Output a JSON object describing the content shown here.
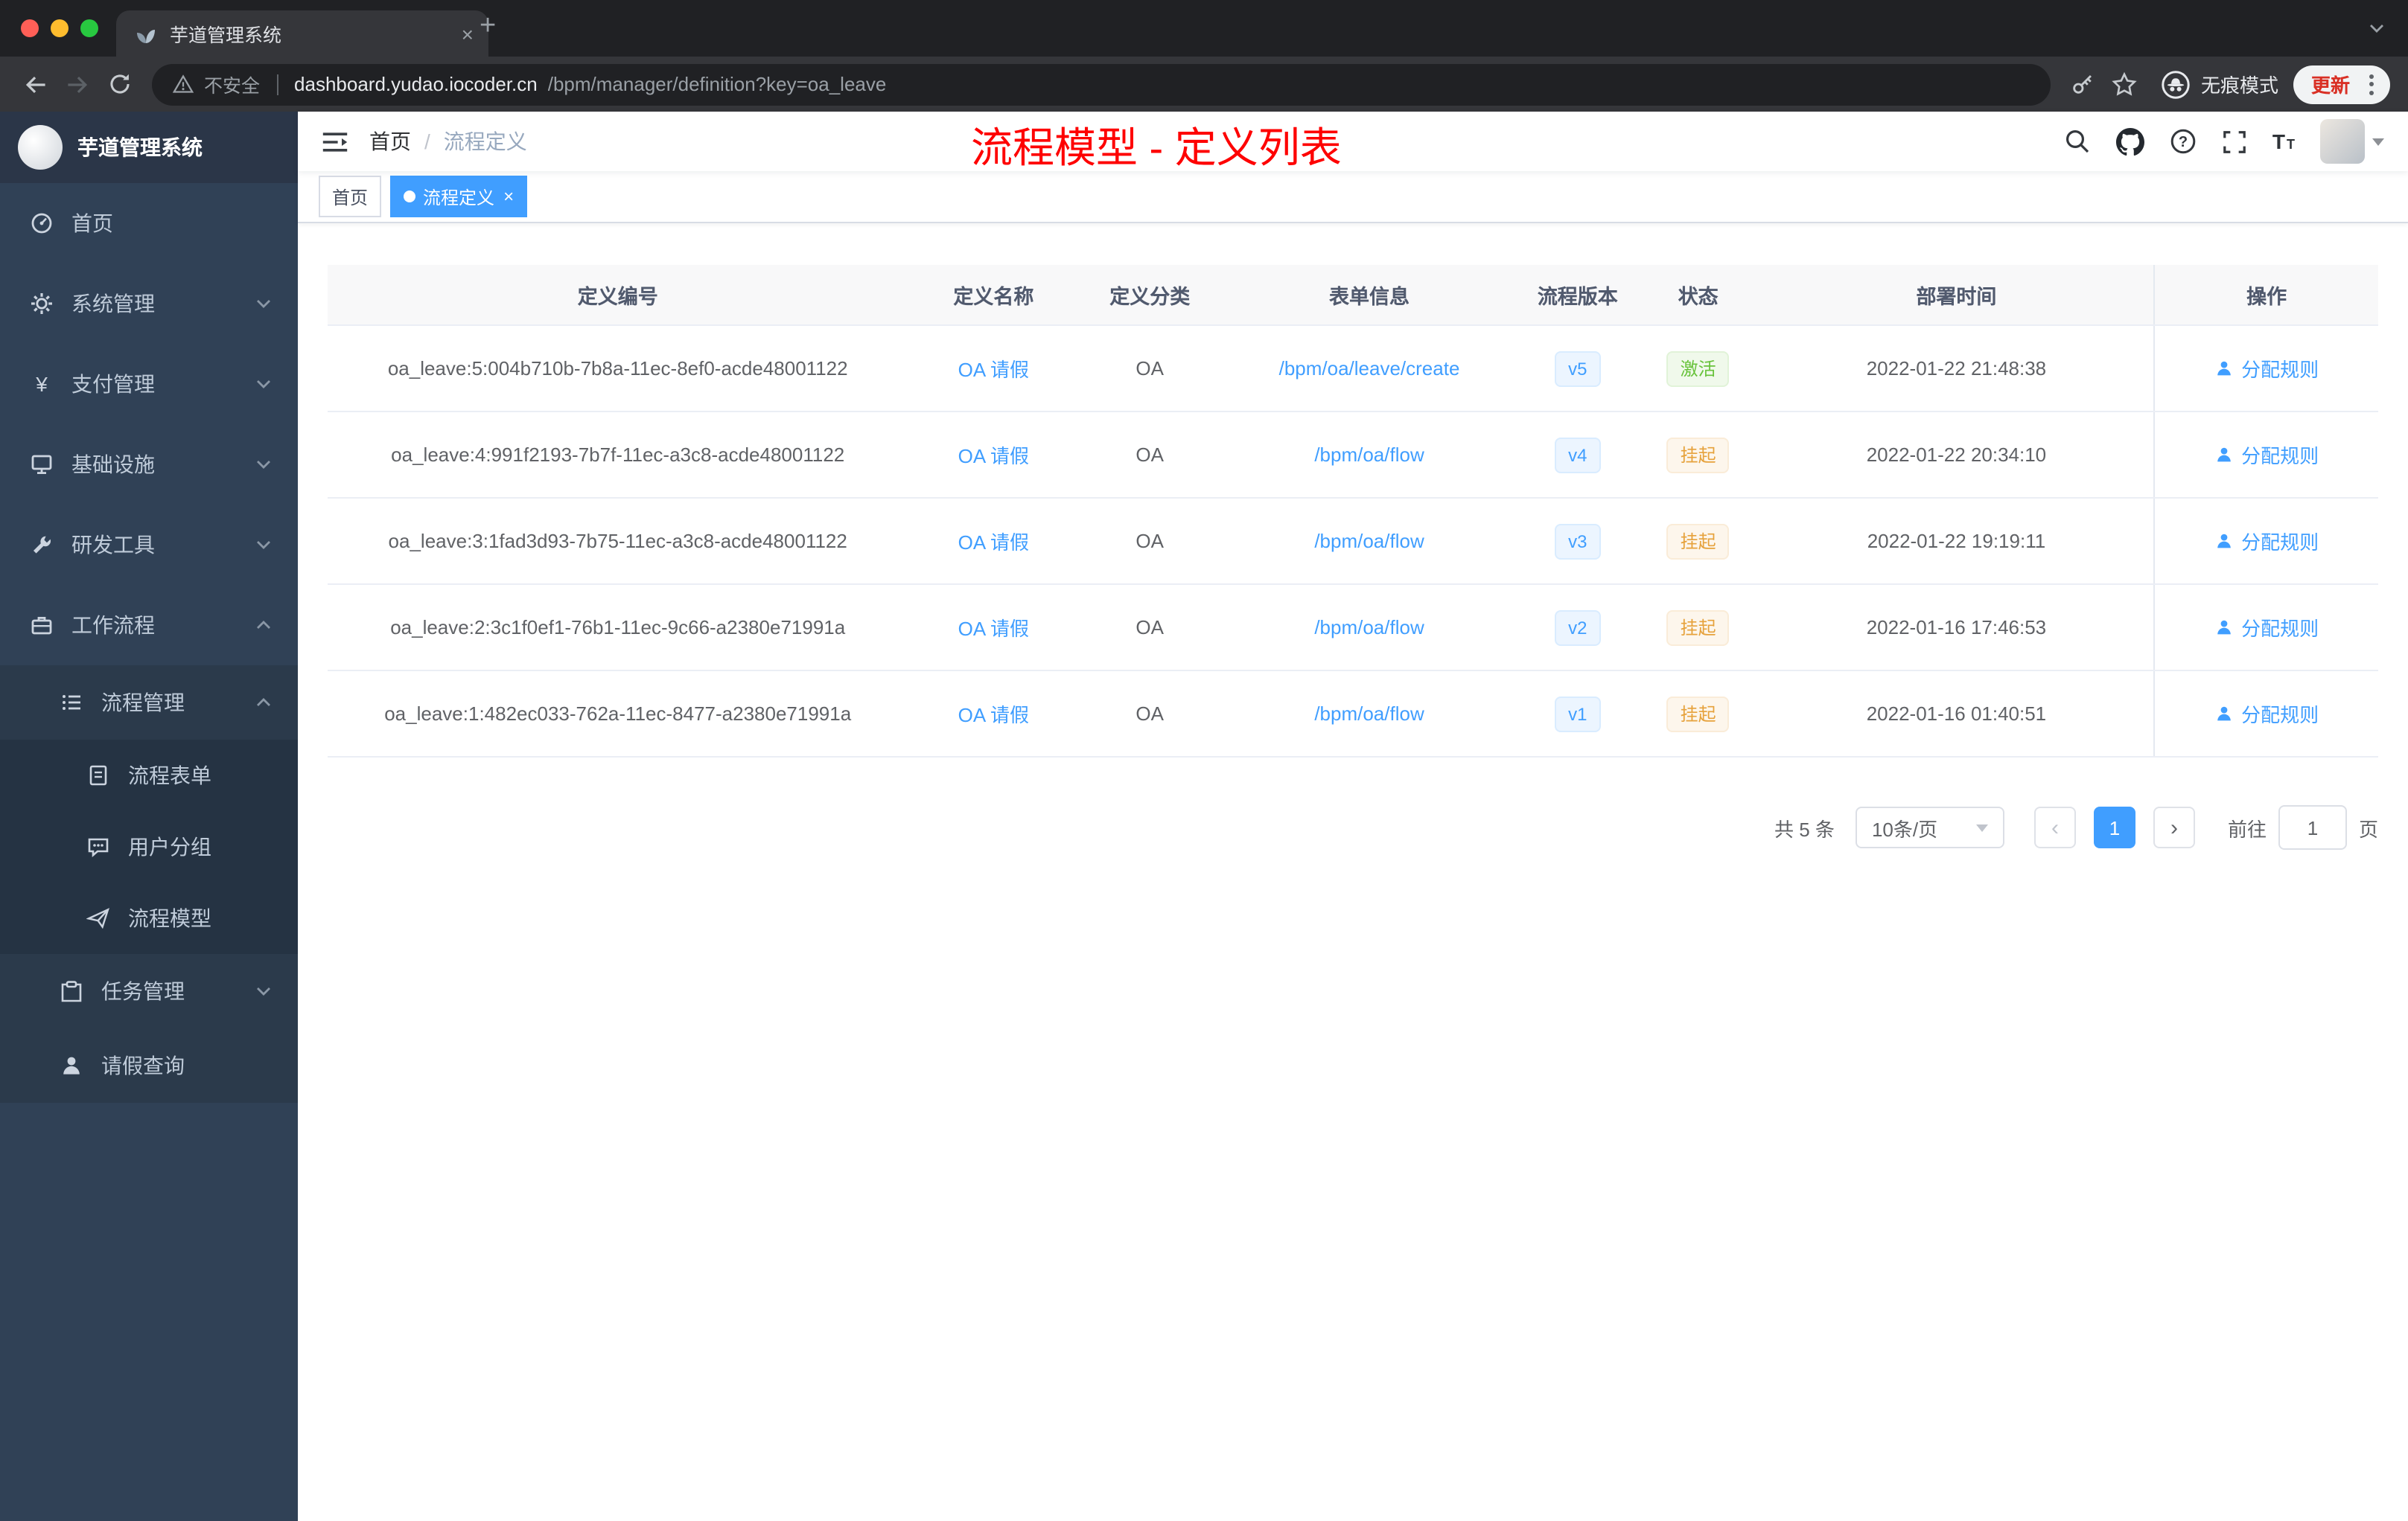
{
  "colors": {
    "accent": "#409eff",
    "sidebar_bg": "#304156",
    "title_red": "#fe0000",
    "status_active_green": "#67c23a",
    "status_suspended_yellow": "#e6a23c",
    "browser_frame": "#202124",
    "browser_toolbar": "#35363a"
  },
  "browser": {
    "tab_title": "芋道管理系统",
    "new_tab": "+",
    "close_tab": "×",
    "security_label": "不安全",
    "url_host": "dashboard.yudao.iocoder.cn",
    "url_path": "/bpm/manager/definition?key=oa_leave",
    "incognito_label": "无痕模式",
    "update_label": "更新"
  },
  "sidebar": {
    "logo_title": "芋道管理系统",
    "items": [
      "首页",
      "系统管理",
      "支付管理",
      "基础设施",
      "研发工具",
      "工作流程",
      "流程管理",
      "流程表单",
      "用户分组",
      "流程模型",
      "任务管理",
      "请假查询"
    ]
  },
  "header": {
    "breadcrumb_home": "首页",
    "breadcrumb_sep": "/",
    "breadcrumb_current": "流程定义",
    "page_title": "流程模型 - 定义列表"
  },
  "tags": {
    "home": "首页",
    "active": "流程定义",
    "close": "×"
  },
  "table": {
    "headers": [
      "定义编号",
      "定义名称",
      "定义分类",
      "表单信息",
      "流程版本",
      "状态",
      "部署时间",
      "操作"
    ],
    "rows": [
      {
        "id": "oa_leave:5:004b710b-7b8a-11ec-8ef0-acde48001122",
        "name": "OA 请假",
        "category": "OA",
        "form": "/bpm/oa/leave/create",
        "version": "v5",
        "status": "激活",
        "time": "2022-01-22 21:48:38",
        "action": "分配规则"
      },
      {
        "id": "oa_leave:4:991f2193-7b7f-11ec-a3c8-acde48001122",
        "name": "OA 请假",
        "category": "OA",
        "form": "/bpm/oa/flow",
        "version": "v4",
        "status": "挂起",
        "time": "2022-01-22 20:34:10",
        "action": "分配规则"
      },
      {
        "id": "oa_leave:3:1fad3d93-7b75-11ec-a3c8-acde48001122",
        "name": "OA 请假",
        "category": "OA",
        "form": "/bpm/oa/flow",
        "version": "v3",
        "status": "挂起",
        "time": "2022-01-22 19:19:11",
        "action": "分配规则"
      },
      {
        "id": "oa_leave:2:3c1f0ef1-76b1-11ec-9c66-a2380e71991a",
        "name": "OA 请假",
        "category": "OA",
        "form": "/bpm/oa/flow",
        "version": "v2",
        "status": "挂起",
        "time": "2022-01-16 17:46:53",
        "action": "分配规则"
      },
      {
        "id": "oa_leave:1:482ec033-762a-11ec-8477-a2380e71991a",
        "name": "OA 请假",
        "category": "OA",
        "form": "/bpm/oa/flow",
        "version": "v1",
        "status": "挂起",
        "time": "2022-01-16 01:40:51",
        "action": "分配规则"
      }
    ]
  },
  "pagination": {
    "total": "共 5 条",
    "page_size": "10条/页",
    "prev": "‹",
    "next": "›",
    "page": "1",
    "goto_label": "前往",
    "goto_value": "1",
    "goto_unit": "页"
  }
}
